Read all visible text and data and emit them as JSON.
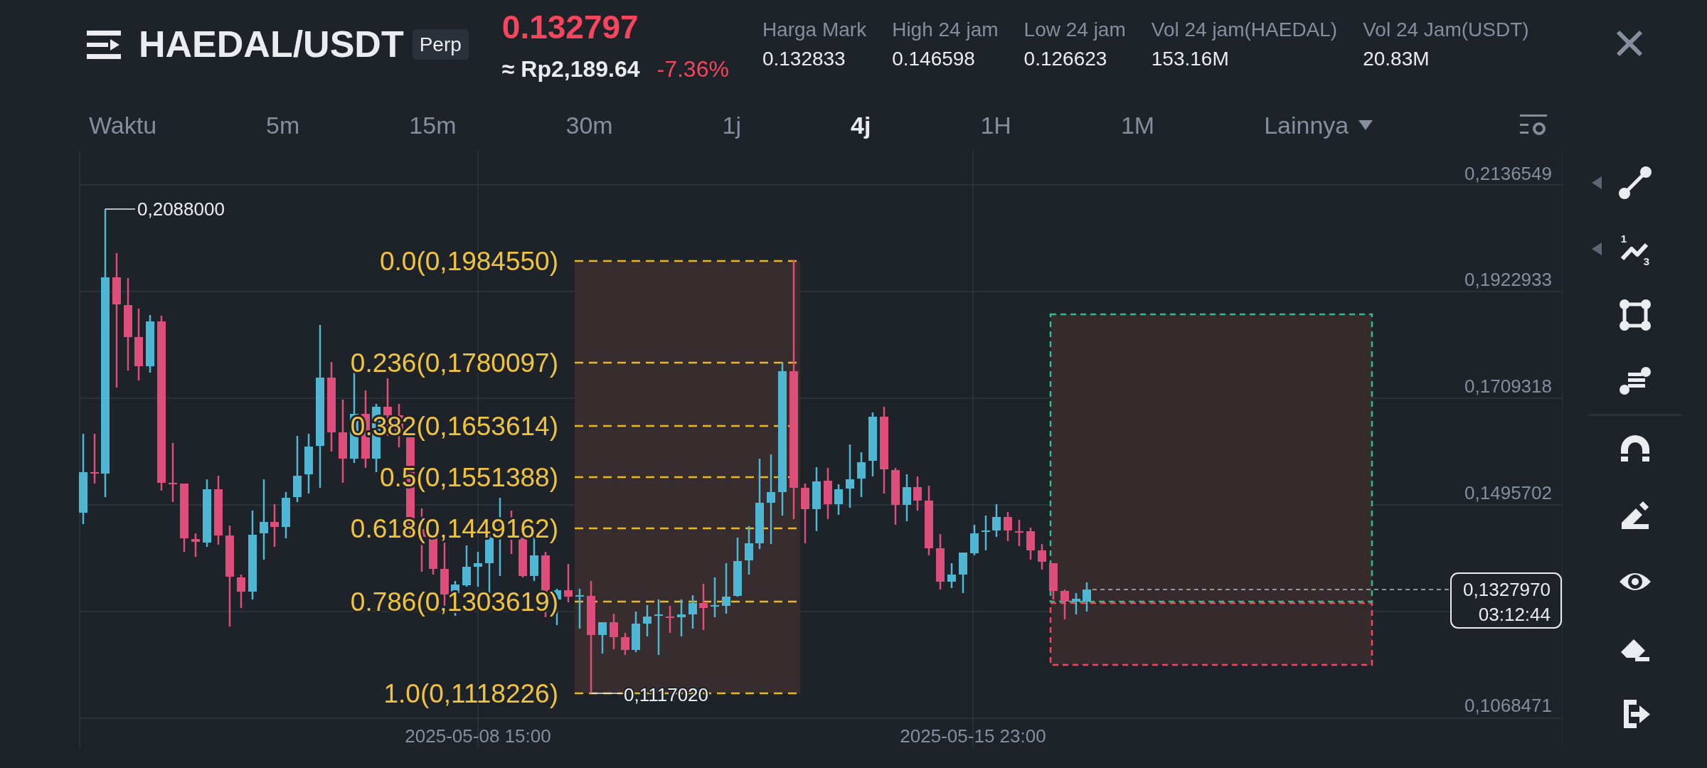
{
  "header": {
    "symbol": "HAEDAL/USDT",
    "badge": "Perp",
    "price": "0.132797",
    "price_converted": "≈ Rp2,189.64",
    "change": "-7.36%",
    "falling": true,
    "stats": [
      {
        "label": "Harga Mark",
        "value": "0.132833"
      },
      {
        "label": "High 24 jam",
        "value": "0.146598"
      },
      {
        "label": "Low 24 jam",
        "value": "0.126623"
      },
      {
        "label": "Vol 24 jam(HAEDAL)",
        "value": "153.16M"
      },
      {
        "label": "Vol 24 Jam(USDT)",
        "value": "20.83M"
      }
    ]
  },
  "intervals": [
    {
      "label": "Waktu",
      "kind": "interval",
      "selected": false
    },
    {
      "label": "5m",
      "kind": "interval",
      "selected": false
    },
    {
      "label": "15m",
      "kind": "interval",
      "selected": false
    },
    {
      "label": "30m",
      "kind": "interval",
      "selected": false
    },
    {
      "label": "1j",
      "kind": "interval",
      "selected": false
    },
    {
      "label": "4j",
      "kind": "interval",
      "selected": true
    },
    {
      "label": "1H",
      "kind": "interval",
      "selected": false
    },
    {
      "label": "1M",
      "kind": "interval",
      "selected": false
    },
    {
      "label": "Lainnya",
      "kind": "menu",
      "selected": false
    }
  ],
  "chart": {
    "price_axis": [
      "0,2136549",
      "0,1922933",
      "0,1709318",
      "0,1495702",
      "0,1068471"
    ],
    "time_axis": [
      "2025-05-08 15:00",
      "2025-05-15 23:00"
    ],
    "high_marker": "0,2088000",
    "low_marker": "0,1117020",
    "fib_levels": [
      "0.0(0,1984550)",
      "0.236(0,1780097)",
      "0.382(0,1653614)",
      "0.5(0,1551388)",
      "0.618(0,1449162)",
      "0.786(0,1303619)",
      "1.0(0,1118226)"
    ],
    "position_tool": {
      "kind": "long"
    },
    "last_price": "0,1327970",
    "countdown": "03:12:44"
  },
  "toolbar": {
    "groups": [
      {
        "tools": [
          {
            "kind": "line",
            "expandable": true
          },
          {
            "kind": "pattern",
            "expandable": true,
            "marks": [
              "1",
              "3"
            ]
          },
          {
            "kind": "rectangle",
            "expandable": false
          },
          {
            "kind": "levels",
            "expandable": false
          }
        ]
      },
      {
        "tools": [
          {
            "kind": "magnet",
            "expandable": false
          },
          {
            "kind": "pencil",
            "expandable": false
          },
          {
            "kind": "eye",
            "expandable": false
          },
          {
            "kind": "eraser",
            "expandable": false
          },
          {
            "kind": "exit",
            "expandable": false
          }
        ]
      }
    ]
  }
}
